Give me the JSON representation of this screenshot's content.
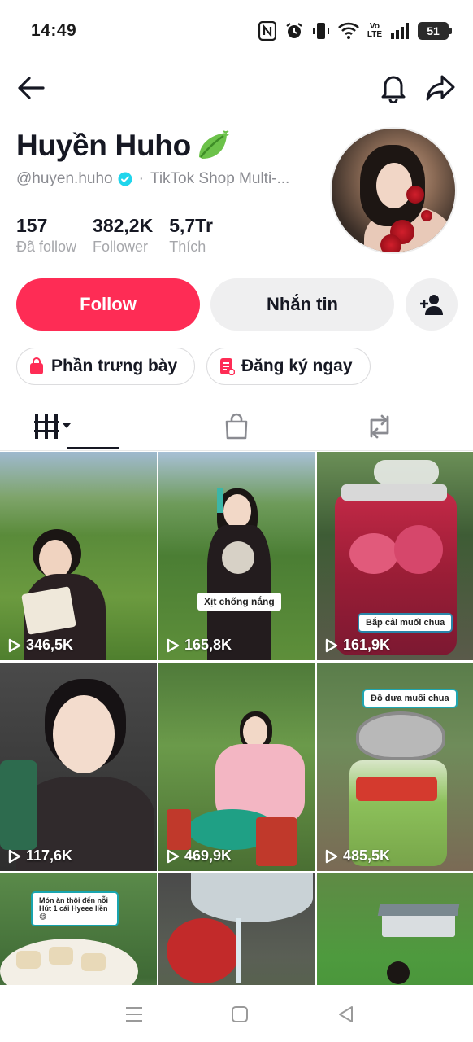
{
  "status_bar": {
    "time": "14:49",
    "battery": "51",
    "volte_line1": "Vo",
    "volte_line2": "LTE"
  },
  "nav": {
    "back_icon": "arrow-left-icon",
    "bell_icon": "bell-icon",
    "share_icon": "share-arrow-icon"
  },
  "profile": {
    "display_name": "Huyền Huho",
    "name_emoji": "leaf-icon",
    "handle": "@huyen.huho",
    "separator": "·",
    "bio_snippet": "TikTok Shop Multi-...",
    "stats": [
      {
        "value": "157",
        "label": "Đã follow"
      },
      {
        "value": "382,2K",
        "label": "Follower"
      },
      {
        "value": "5,7Tr",
        "label": "Thích"
      }
    ]
  },
  "actions": {
    "follow_label": "Follow",
    "message_label": "Nhắn tin",
    "add_friend_icon": "add-person-icon"
  },
  "chips": {
    "showcase_label": "Phần trưng bày",
    "register_label": "Đăng ký ngay"
  },
  "tabs": {
    "videos_icon": "grid-bars-icon",
    "shop_icon": "shopping-bag-icon",
    "repost_icon": "repost-icon",
    "active": "videos"
  },
  "videos": [
    {
      "views": "346,5K",
      "caption": ""
    },
    {
      "views": "165,8K",
      "caption": "Xịt chống nắng"
    },
    {
      "views": "161,9K",
      "caption": "Bắp cải muối chua"
    },
    {
      "views": "117,6K",
      "caption": ""
    },
    {
      "views": "469,9K",
      "caption": ""
    },
    {
      "views": "485,5K",
      "caption": "Đồ dưa muối chua"
    },
    {
      "views": "",
      "caption": "Món ăn thôi đến nỗi Hút 1 cái Hyeee liền 😅"
    },
    {
      "views": "",
      "caption": ""
    },
    {
      "views": "",
      "caption": ""
    }
  ],
  "colors": {
    "accent": "#fe2c55",
    "secondary_button": "#efeff0",
    "text_primary": "#161823",
    "text_muted": "#8a8b91",
    "verified": "#20d5ec"
  }
}
